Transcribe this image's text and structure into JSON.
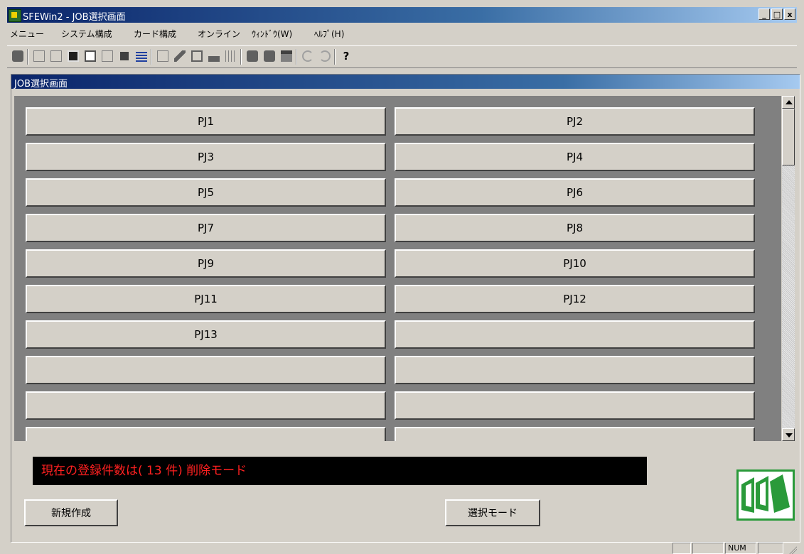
{
  "window": {
    "title": "SFEWin2 - JOB選択画面 ",
    "controls": [
      "_",
      "□",
      "x"
    ]
  },
  "menubar": {
    "items": [
      "メニュー",
      "システム構成",
      "カード構成",
      "オンライン",
      "ｳｨﾝﾄﾞｳ(W)",
      "ﾍﾙﾌﾟ(H)"
    ]
  },
  "toolbar": {
    "icons": [
      "job-stop-icon",
      "job-select-icon",
      "job-info-icon",
      "calculator-icon",
      "document-icon",
      "job-copy-icon",
      "job-save-icon",
      "environment-settings-icon",
      "system-config-icon",
      "lightning-icon",
      "card-icon",
      "blocks-icon",
      "waveform-icon",
      "speech-bubble-icon",
      "speech-bubble-2-icon",
      "print-icon",
      "undo-icon",
      "redo-icon",
      "help-icon"
    ]
  },
  "child_window": {
    "title": "JOB選択画面"
  },
  "job_grid": {
    "cells": [
      "PJ1",
      "PJ2",
      "PJ3",
      "PJ4",
      "PJ5",
      "PJ6",
      "PJ7",
      "PJ8",
      "PJ9",
      "PJ10",
      "PJ11",
      "PJ12",
      "PJ13",
      "",
      "",
      "",
      "",
      "",
      "",
      ""
    ]
  },
  "status_message": "現在の登録件数は( 13  件) 削除モード",
  "buttons": {
    "new": "新規作成",
    "select_mode": "選択モード"
  },
  "statusbar": {
    "num": "NUM"
  },
  "colors": {
    "title_blue": "#0a246a",
    "status_text": "#ff2020",
    "logo_green": "#2a9a3a"
  }
}
